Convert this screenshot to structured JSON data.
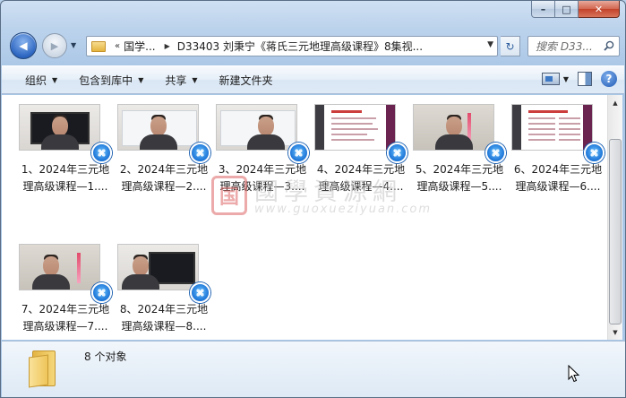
{
  "window": {
    "caption_buttons": {
      "minimize": "–",
      "maximize": "□",
      "close": "✕"
    }
  },
  "nav": {
    "back_glyph": "◀",
    "forward_glyph": "▶",
    "history_glyph": "▼",
    "address": {
      "overflow": "«",
      "segments": [
        "国学...",
        "D33403 刘秉宁《蒋氏三元地理高级课程》8集视..."
      ],
      "separator": "▶",
      "dropdown": "▼"
    },
    "refresh_glyph": "↻",
    "search_placeholder": "搜索 D33..."
  },
  "commandbar": {
    "items": [
      {
        "label": "组织",
        "has_dropdown": true
      },
      {
        "label": "包含到库中",
        "has_dropdown": true
      },
      {
        "label": "共享",
        "has_dropdown": true
      },
      {
        "label": "新建文件夹",
        "has_dropdown": false
      }
    ],
    "dropdown_glyph": "▼",
    "help_glyph": "?"
  },
  "files": [
    {
      "line1": "1、2024年三元地",
      "line2": "理高级课程—1....",
      "thumb": "monitor"
    },
    {
      "line1": "2、2024年三元地",
      "line2": "理高级课程—2....",
      "thumb": "board"
    },
    {
      "line1": "3、2024年三元地",
      "line2": "理高级课程—3....",
      "thumb": "board"
    },
    {
      "line1": "4、2024年三元地",
      "line2": "理高级课程—4....",
      "thumb": "doc"
    },
    {
      "line1": "5、2024年三元地",
      "line2": "理高级课程—5....",
      "thumb": "wall"
    },
    {
      "line1": "6、2024年三元地",
      "line2": "理高级课程—6....",
      "thumb": "doc"
    },
    {
      "line1": "7、2024年三元地",
      "line2": "理高级课程—7....",
      "thumb": "wall"
    },
    {
      "line1": "8、2024年三元地",
      "line2": "理高级课程—8....",
      "thumb": "monitor"
    }
  ],
  "watermark": {
    "seal": "国",
    "text": "國學資源網",
    "url": "www.guoxueziyuan.com"
  },
  "scrollbar": {
    "up_glyph": "▲",
    "down_glyph": "▼"
  },
  "details": {
    "count": "8 个对象"
  },
  "colors": {
    "accent": "#1b73d6",
    "frame": "#b9d1ea",
    "close": "#c2422a"
  }
}
